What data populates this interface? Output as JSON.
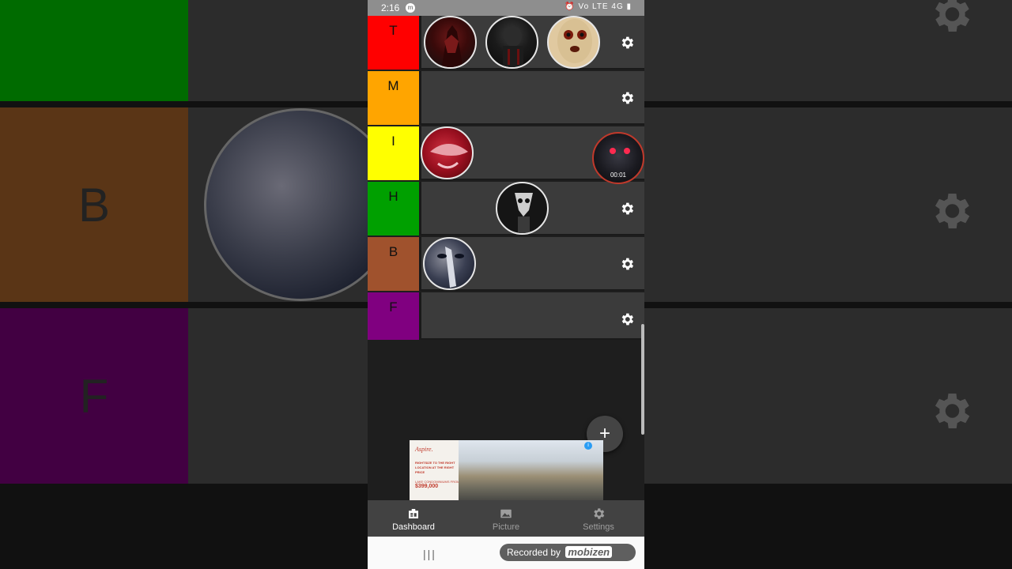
{
  "status_bar": {
    "time": "2:16",
    "icons": "⏰ Vo LTE 4G ▮"
  },
  "tiers": [
    {
      "label": "T",
      "color": "#ff0000",
      "items": [
        "dark-red-figure",
        "dark-masked-figure",
        "scp-173-face"
      ],
      "has_gear": true
    },
    {
      "label": "M",
      "color": "#ffa500",
      "items": [],
      "has_gear": true
    },
    {
      "label": "I",
      "color": "#ffff00",
      "items": [
        "red-mouth-creature",
        "red-eyed-creature-dragging"
      ],
      "has_gear": false
    },
    {
      "label": "H",
      "color": "#00a000",
      "items": [
        "pale-skull-figure"
      ],
      "has_gear": true
    },
    {
      "label": "B",
      "color": "#a0522d",
      "items": [
        "plague-mask-face"
      ],
      "has_gear": true
    },
    {
      "label": "F",
      "color": "#800080",
      "items": [],
      "has_gear": true
    }
  ],
  "drag_timer": "00:01",
  "fab_label": "+",
  "ad": {
    "brand": "Aspire.",
    "copy": "RIGHTSIZE TO THE RIGHT LOCATION AT THE RIGHT PRICE",
    "sub": "LAKE CONDOMINIUMS FROM",
    "price": "$399,000"
  },
  "bottom_nav": {
    "dashboard": "Dashboard",
    "picture": "Picture",
    "settings": "Settings"
  },
  "recorder": {
    "text": "Recorded by",
    "brand": "mobizen"
  },
  "background": {
    "labels": [
      "B",
      "F"
    ]
  },
  "colors": {
    "nav_bg": "#424242",
    "tier_row_bg": "#3b3b3b",
    "accent_active": "#ffffff"
  }
}
